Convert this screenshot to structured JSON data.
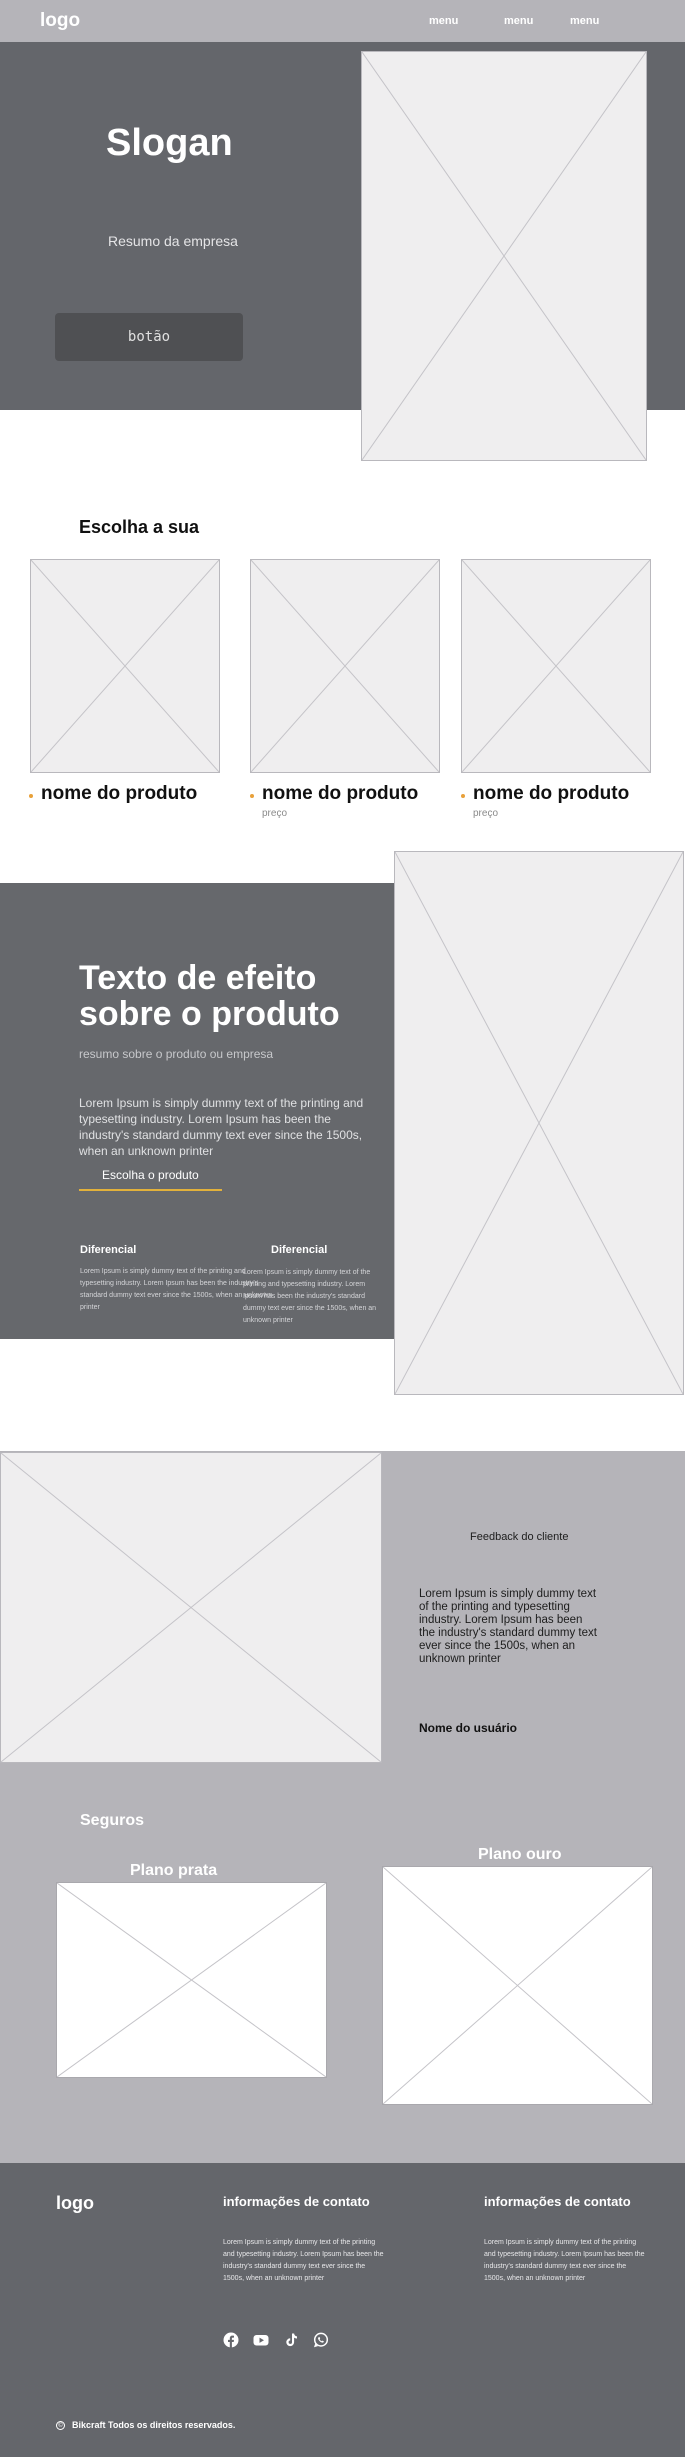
{
  "header": {
    "logo": "logo",
    "menu": [
      "menu",
      "menu",
      "menu"
    ]
  },
  "hero": {
    "slogan": "Slogan",
    "summary": "Resumo da empresa",
    "button_label": "botão"
  },
  "products": {
    "title": "Escolha a sua",
    "items": [
      {
        "name": "nome do produto",
        "price": ""
      },
      {
        "name": "nome do produto",
        "price": "preço"
      },
      {
        "name": "nome do produto",
        "price": "preço"
      }
    ]
  },
  "effect": {
    "title": "Texto de efeito sobre o produto",
    "subtitle": "resumo sobre o produto ou empresa",
    "lorem": "Lorem Ipsum is simply dummy text of the printing and typesetting industry. Lorem Ipsum has been the industry's standard dummy text ever since the 1500s, when an unknown printer",
    "link_label": "Escolha o produto",
    "differentials": [
      {
        "title": "Diferencial",
        "text": "Lorem Ipsum is simply dummy text of the printing and typesetting industry. Lorem Ipsum has been the industry's standard dummy text ever since the 1500s, when an unknown printer"
      },
      {
        "title": "Diferencial",
        "text": "Lorem Ipsum is simply dummy text of the printing and typesetting industry. Lorem Ipsum has been the industry's standard dummy text ever since the 1500s, when an unknown printer"
      }
    ]
  },
  "feedback": {
    "title": "Feedback do cliente",
    "text": "Lorem Ipsum is simply dummy text of the printing and typesetting industry. Lorem Ipsum has been the industry's standard dummy text ever since the 1500s, when an unknown printer",
    "user": "Nome do usuário"
  },
  "insurance": {
    "title": "Seguros",
    "plans": [
      {
        "name": "Plano prata"
      },
      {
        "name": "Plano ouro"
      }
    ]
  },
  "footer": {
    "logo": "logo",
    "contact_columns": [
      {
        "title": "informações de contato",
        "text": "Lorem Ipsum is simply dummy text of the printing and typesetting industry. Lorem Ipsum has been the industry's standard dummy text ever since the 1500s, when an unknown printer"
      },
      {
        "title": "informações de contato",
        "text": "Lorem Ipsum is simply dummy text of the printing and typesetting industry. Lorem Ipsum has been the industry's standard dummy text ever since the 1500s, when an unknown printer"
      }
    ],
    "social_icons": [
      "facebook-icon",
      "youtube-icon",
      "tiktok-icon",
      "whatsapp-icon"
    ],
    "copyright": "Bikcraft Todos os direitos reservados."
  },
  "colors": {
    "header_bg": "#b5b4b9",
    "dark_bg": "#64666b",
    "accent": "#e2b13b",
    "button_bg": "#4f5053"
  }
}
